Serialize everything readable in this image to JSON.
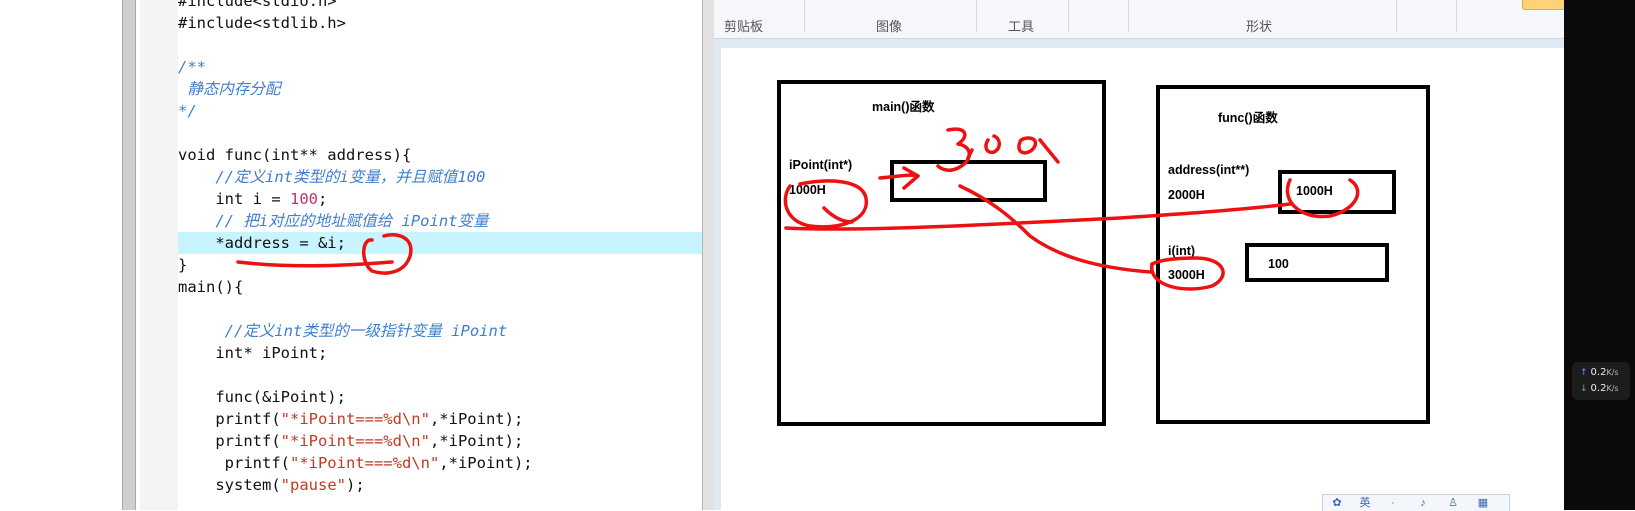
{
  "editor": {
    "lines": [
      {
        "parts": [
          {
            "t": "#include<stdio.h>",
            "c": ""
          }
        ]
      },
      {
        "parts": [
          {
            "t": "#include<stdlib.h>",
            "c": ""
          }
        ]
      },
      {
        "parts": []
      },
      {
        "parts": [
          {
            "t": "/**",
            "c": "cm"
          }
        ]
      },
      {
        "parts": [
          {
            "t": " 静态内存分配",
            "c": "cm"
          }
        ]
      },
      {
        "parts": [
          {
            "t": "*/",
            "c": "cm"
          }
        ]
      },
      {
        "parts": []
      },
      {
        "parts": [
          {
            "t": "void func(int** address){",
            "c": ""
          }
        ]
      },
      {
        "parts": [
          {
            "t": "    //定义int类型的i变量，并且赋值100",
            "c": "cm"
          }
        ]
      },
      {
        "parts": [
          {
            "t": "    int i = ",
            "c": ""
          },
          {
            "t": "100",
            "c": "num"
          },
          {
            "t": ";",
            "c": ""
          }
        ]
      },
      {
        "parts": [
          {
            "t": "    // 把i对应的地址赋值给 iPoint变量",
            "c": "cm"
          }
        ]
      },
      {
        "parts": [
          {
            "t": "    *address = &i;",
            "c": ""
          }
        ],
        "highlight": true
      },
      {
        "parts": [
          {
            "t": "}",
            "c": ""
          }
        ]
      },
      {
        "parts": [
          {
            "t": "main(){",
            "c": ""
          }
        ]
      },
      {
        "parts": []
      },
      {
        "parts": [
          {
            "t": "     //定义int类型的一级指针变量 iPoint",
            "c": "cm"
          }
        ]
      },
      {
        "parts": [
          {
            "t": "    int* iPoint;",
            "c": ""
          }
        ]
      },
      {
        "parts": []
      },
      {
        "parts": [
          {
            "t": "    func(&iPoint);",
            "c": ""
          }
        ]
      },
      {
        "parts": [
          {
            "t": "    printf(",
            "c": ""
          },
          {
            "t": "\"*iPoint===%d\\n\"",
            "c": "str"
          },
          {
            "t": ",*iPoint);",
            "c": ""
          }
        ]
      },
      {
        "parts": [
          {
            "t": "    printf(",
            "c": ""
          },
          {
            "t": "\"*iPoint===%d\\n\"",
            "c": "str"
          },
          {
            "t": ",*iPoint);",
            "c": ""
          }
        ]
      },
      {
        "parts": [
          {
            "t": "     printf(",
            "c": ""
          },
          {
            "t": "\"*iPoint===%d\\n\"",
            "c": "str"
          },
          {
            "t": ",*iPoint);",
            "c": ""
          }
        ]
      },
      {
        "parts": [
          {
            "t": "    system(",
            "c": ""
          },
          {
            "t": "\"pause\"",
            "c": "str"
          },
          {
            "t": ");",
            "c": ""
          }
        ]
      }
    ]
  },
  "ribbon": {
    "groups": [
      "剪贴板",
      "图像",
      "工具",
      "形状"
    ]
  },
  "diagram": {
    "main_title": "main()函数",
    "func_title": "func()函数",
    "ipoint_label": "iPoint(int*)",
    "ipoint_addr": "1000H",
    "address_label": "address(int**)",
    "address_addr": "2000H",
    "address_value": "1000H",
    "i_label": "i(int)",
    "i_addr": "3000H",
    "i_value": "100"
  },
  "network": {
    "up": "0.2",
    "down": "0.2",
    "unit": "K/s"
  },
  "colors": {
    "highlight": "#c8f4ff",
    "comment": "#3f7fcf",
    "string": "#c23a20",
    "number": "#c0306a",
    "ink": "#ee1111"
  }
}
